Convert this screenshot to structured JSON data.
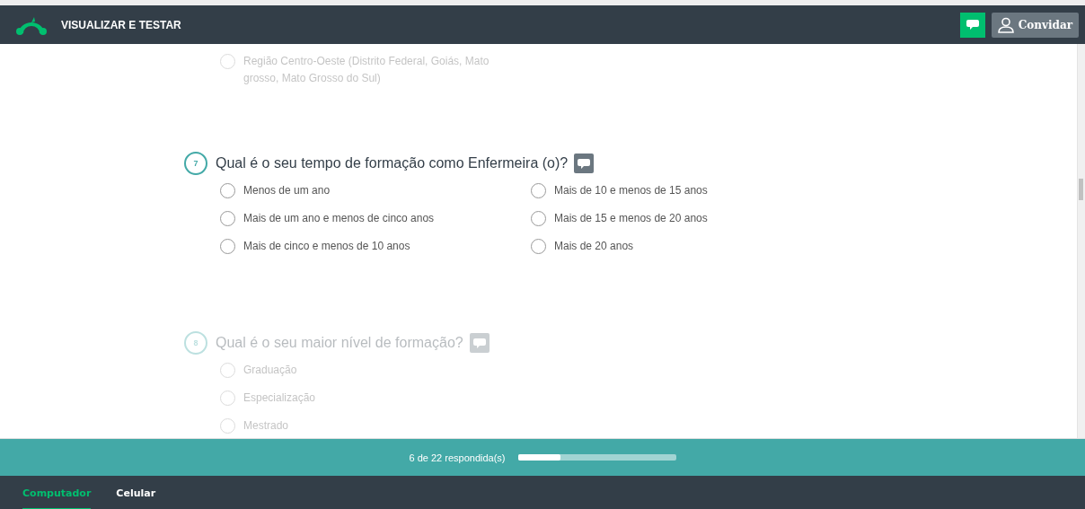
{
  "header": {
    "title": "VISUALIZAR E TESTAR",
    "invite_button": "Convidar"
  },
  "questions": [
    {
      "dimmed": true,
      "options": [
        {
          "label": "Região Centro-Oeste (Distrito Federal, Goiás, Mato grosso, Mato Grosso do Sul)",
          "selected": false
        }
      ]
    },
    {
      "dimmed": false,
      "number": "7",
      "title": "Qual é o seu tempo de formação como Enfermeira (o)?",
      "kind": "grid",
      "options": [
        {
          "label": "Menos de um ano",
          "selected": false
        },
        {
          "label": "Mais de um ano e menos de cinco anos",
          "selected": false
        },
        {
          "label": "Mais de cinco e menos de 10 anos",
          "selected": false
        },
        {
          "label": "Mais de 10 e menos de 15 anos",
          "selected": false
        },
        {
          "label": "Mais de 15 e menos de 20 anos",
          "selected": false
        },
        {
          "label": "Mais de 20 anos",
          "selected": false
        }
      ]
    },
    {
      "dimmed": true,
      "number": "8",
      "title": "Qual é o seu maior nível de formação?",
      "kind": "list",
      "options": [
        {
          "label": "Graduação",
          "selected": false
        },
        {
          "label": "Especialização",
          "selected": false
        },
        {
          "label": "Mestrado",
          "selected": false
        }
      ]
    }
  ],
  "progress": {
    "text": "6 de 22 respondida(s)",
    "level": 0.27
  },
  "tabs": [
    {
      "label": "Computador",
      "selected": true
    },
    {
      "label": "Celular",
      "selected": false
    }
  ]
}
